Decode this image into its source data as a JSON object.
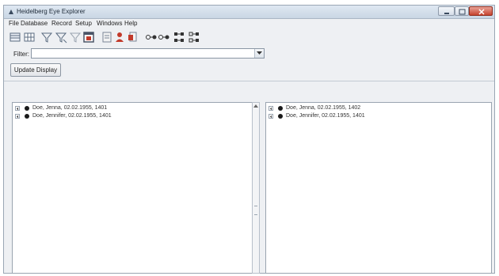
{
  "window": {
    "title": "Heidelberg Eye Explorer"
  },
  "menubar": {
    "items": [
      "File",
      "Database",
      "Record",
      "Setup",
      "Windows",
      "Help"
    ]
  },
  "toolbar": {
    "icons": [
      "database-icon",
      "grid-view-icon",
      "filter-icon",
      "filter-edit-icon",
      "filter-remove-icon",
      "calendar-icon",
      "edit-record-icon",
      "patient-icon",
      "export-icon",
      "link-icon",
      "link-alt-icon",
      "tree-expand-icon",
      "tree-collapse-icon"
    ]
  },
  "filter": {
    "label": "Filter:",
    "value": ""
  },
  "update_button": {
    "label": "Update Display"
  },
  "left_panel": {
    "rows": [
      {
        "label": "Doe, Jenna, 02.02.1955, 1401"
      },
      {
        "label": "Doe, Jennifer, 02.02.1955, 1401"
      }
    ]
  },
  "right_panel": {
    "rows": [
      {
        "label": "Doe, Jenna, 02.02.1955, 1402"
      },
      {
        "label": "Doe, Jennifer, 02.02.1955, 1401"
      }
    ]
  },
  "colors": {
    "close_button": "#c6442f",
    "window_background": "#eef0f3",
    "panel_background": "#ffffff"
  }
}
